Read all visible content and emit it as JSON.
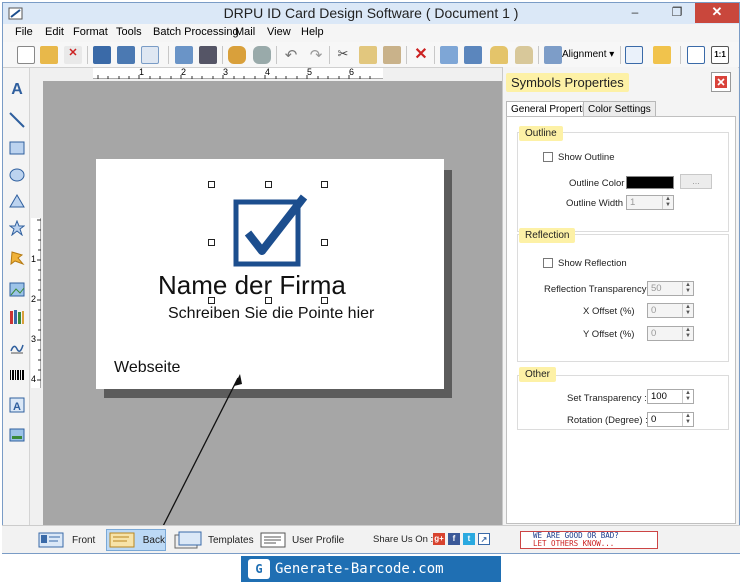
{
  "window": {
    "title": "DRPU ID Card Design Software ( Document 1 )",
    "minimize": "–",
    "maximize": "❐",
    "close": "✕"
  },
  "menu": [
    {
      "label": "File"
    },
    {
      "label": "Edit"
    },
    {
      "label": "Format"
    },
    {
      "label": "Tools"
    },
    {
      "label": "Batch Processing"
    },
    {
      "label": "Mail"
    },
    {
      "label": "View"
    },
    {
      "label": "Help"
    }
  ],
  "toolbar": {
    "alignment_label": "Alignment ▾"
  },
  "ruler": {
    "h_ticks": [
      "1",
      "2",
      "3",
      "4",
      "5",
      "6"
    ],
    "v_ticks": [
      "1",
      "2",
      "3",
      "4"
    ]
  },
  "card": {
    "company_name": "Name der Firma",
    "slogan": "Schreiben Sie die Pointe hier",
    "website": "Webseite",
    "symbol": "checkbox-checked-icon",
    "symbol_color": "#1c4e8e"
  },
  "panel": {
    "title": "Symbols Properties",
    "tabs": [
      "General Properties",
      "Color Settings"
    ],
    "active_tab": "General Properties",
    "outline": {
      "group": "Outline",
      "show_label": "Show Outline",
      "show_checked": false,
      "color_label": "Outline Color",
      "color": "#000000",
      "color_button": "...",
      "width_label": "Outline Width",
      "width": "1"
    },
    "reflection": {
      "group": "Reflection",
      "show_label": "Show Reflection",
      "show_checked": false,
      "transparency_label": "Reflection Transparency",
      "transparency": "50",
      "xoffset_label": "X Offset (%)",
      "xoffset": "0",
      "yoffset_label": "Y Offset (%)",
      "yoffset": "0"
    },
    "other": {
      "group": "Other",
      "transparency_label": "Set Transparency :",
      "transparency": "100",
      "rotation_label": "Rotation (Degree) :",
      "rotation": "0"
    }
  },
  "bottom": {
    "front": "Front",
    "back": "Back",
    "templates": "Templates",
    "user_profile": "User Profile",
    "share": "Share Us On :",
    "feedback_line1": "WE ARE GOOD OR BAD?",
    "feedback_line2": "LET OTHERS KNOW..."
  },
  "brand": {
    "text": "Generate-Barcode.com",
    "logo": "G"
  }
}
